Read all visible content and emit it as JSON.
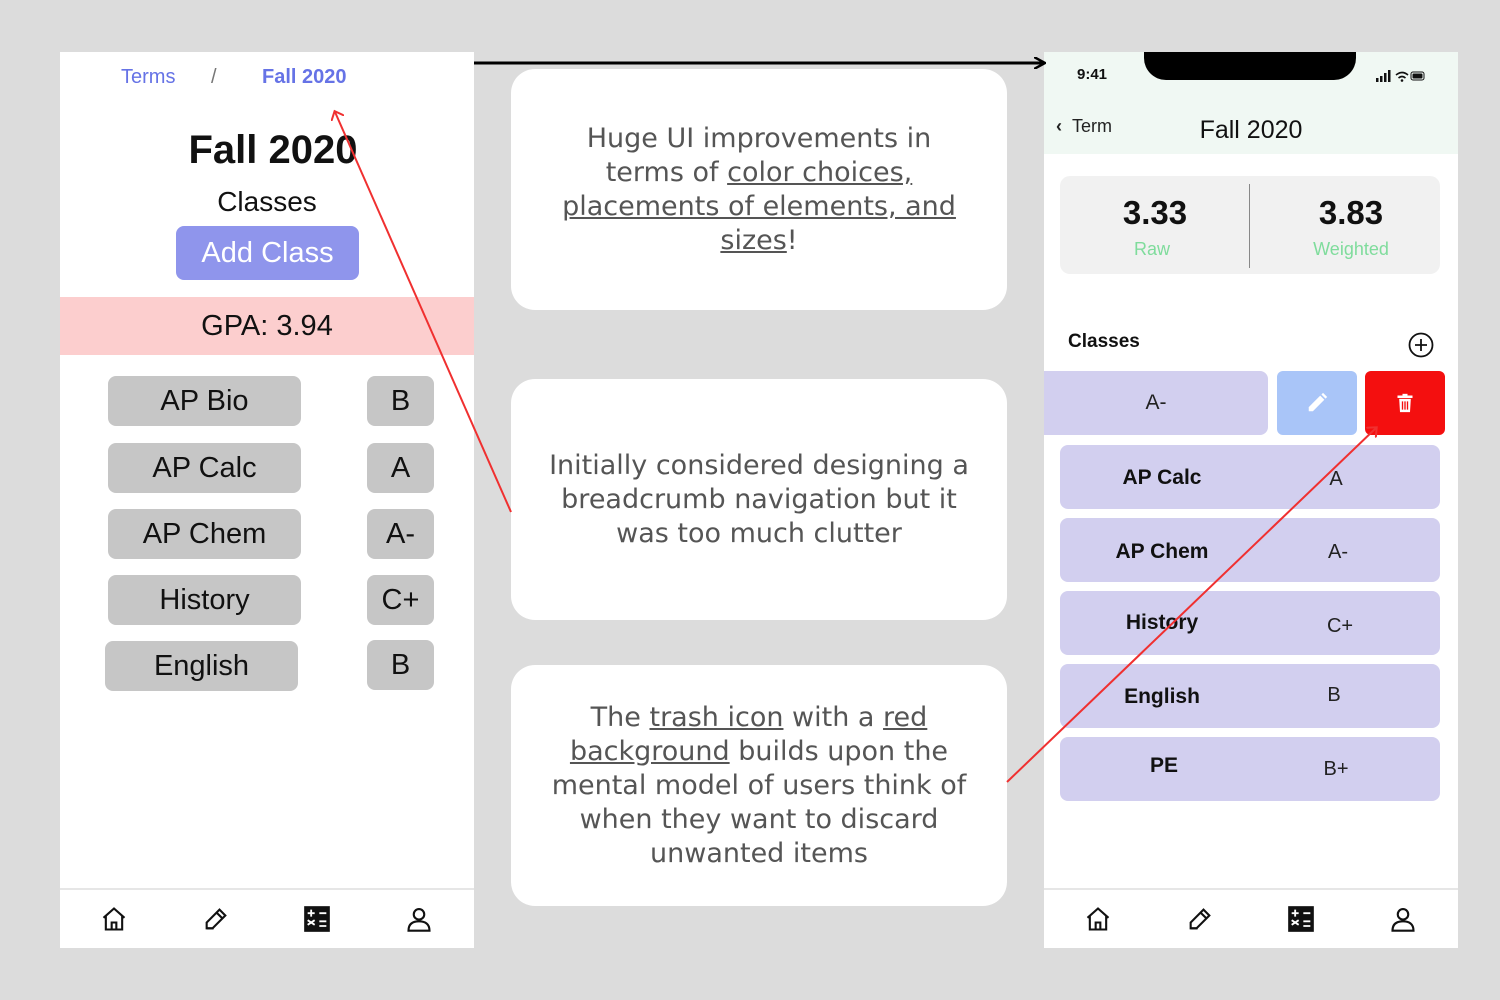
{
  "left_screen": {
    "breadcrumb": {
      "terms": "Terms",
      "separator": "/",
      "current": "Fall 2020"
    },
    "title": "Fall 2020",
    "classes_label": "Classes",
    "add_class_label": "Add Class",
    "gpa": "GPA: 3.94",
    "classes": [
      {
        "name": "AP Bio",
        "grade": "B"
      },
      {
        "name": "AP Calc",
        "grade": "A"
      },
      {
        "name": "AP Chem",
        "grade": "A-"
      },
      {
        "name": "History",
        "grade": "C+"
      },
      {
        "name": "English",
        "grade": "B"
      }
    ],
    "tabs": [
      "home-icon",
      "edit-icon",
      "calculator-icon",
      "profile-icon"
    ]
  },
  "notes": {
    "note1": {
      "pre": "Huge UI improvements in terms of ",
      "underlined": "color choices, placements of elements, and sizes",
      "post": "!"
    },
    "note2": "Initially considered designing a breadcrumb navigation but it was too much clutter",
    "note3": {
      "pre": "The ",
      "u1": "trash icon",
      "mid": " with a ",
      "u2": "red background",
      "post": " builds upon the mental model of users think of when they want to discard unwanted items"
    }
  },
  "right_screen": {
    "status_time": "9:41",
    "back_label": "Term",
    "title": "Fall 2020",
    "gpa_raw": {
      "value": "3.33",
      "label": "Raw"
    },
    "gpa_weighted": {
      "value": "3.83",
      "label": "Weighted"
    },
    "classes_label": "Classes",
    "swiped_row_grade": "A-",
    "classes": [
      {
        "name": "AP Calc",
        "grade": "A"
      },
      {
        "name": "AP Chem",
        "grade": "A-"
      },
      {
        "name": "History",
        "grade": "C+"
      },
      {
        "name": "English",
        "grade": "B"
      },
      {
        "name": "PE",
        "grade": "B+"
      }
    ],
    "tabs": [
      "home-icon",
      "edit-icon",
      "calculator-icon",
      "profile-icon"
    ]
  },
  "colors": {
    "breadcrumb_link": "#6673e6",
    "add_button": "#8f95ec",
    "gpa_banner": "#fccece",
    "class_pill_left": "#c6c6c6",
    "class_row_right": "#d2cfef",
    "edit_action": "#a9c5f8",
    "delete_action": "#f40f0f",
    "gpa_label": "#7fdc9c",
    "annotation_arrow": "#f03030"
  }
}
